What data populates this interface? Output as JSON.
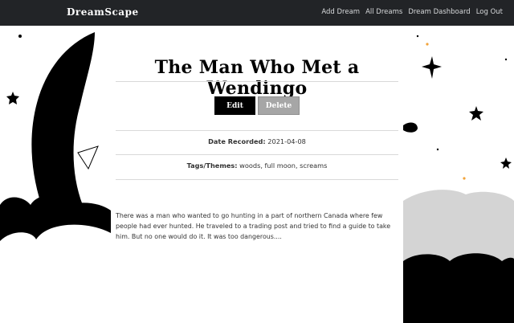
{
  "nav": {
    "brand": "DreamScape",
    "links": [
      "Add Dream",
      "All Dreams",
      "Dream Dashboard",
      "Log Out"
    ]
  },
  "dream": {
    "title": "The Man Who Met a Wendingo",
    "edit_label": "Edit",
    "delete_label": "Delete",
    "date_label": "Date Recorded:",
    "date_value": "2021-04-08",
    "tags_label": "Tags/Themes:",
    "tags_value": "woods, full moon, screams",
    "description": "There was a man who wanted to go hunting in a part of northern Canada where few people had ever hunted. He traveled to a trading post and tried to find a guide to take him. But no one would do it. It was too dangerous...."
  },
  "colors": {
    "navbar": "#222427",
    "edit_button": "#000000",
    "delete_button": "#a6a6a6"
  },
  "icons": [
    "star-icon",
    "moon-illustration",
    "cloud-illustration"
  ]
}
